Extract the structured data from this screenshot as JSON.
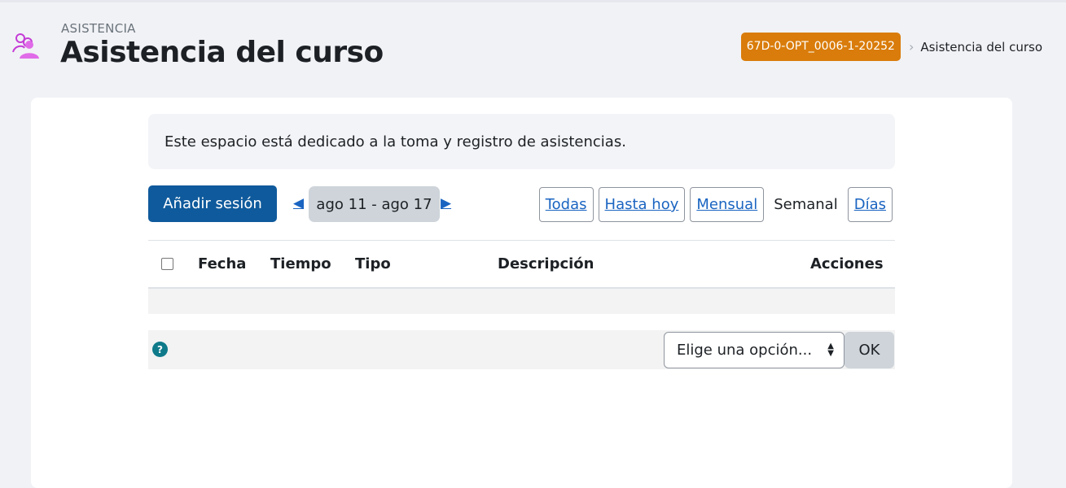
{
  "header": {
    "kicker": "ASISTENCIA",
    "title": "Asistencia del curso",
    "icon": "users-icon"
  },
  "breadcrumb": {
    "course_badge": "67D-0-OPT_0006-1-20252",
    "separator": "›",
    "current": "Asistencia del curso"
  },
  "intro": {
    "text": "Este espacio está dedicado a la toma y registro de asistencias."
  },
  "toolbar": {
    "add_session_label": "Añadir sesión",
    "prev_label": "◀",
    "date_range": "ago 11 - ago 17",
    "next_label": "▶",
    "views": {
      "all": "Todas",
      "until_today": "Hasta hoy",
      "monthly": "Mensual",
      "weekly": "Semanal",
      "days": "Días"
    }
  },
  "table": {
    "columns": [
      "Fecha",
      "Tiempo",
      "Tipo",
      "Descripción",
      "Acciones"
    ],
    "rows": []
  },
  "footer": {
    "help_label": "?",
    "select_value": "Elige una opción...",
    "ok_label": "OK"
  },
  "colors": {
    "primary": "#0f5a9c",
    "badge": "#d97c0b",
    "link": "#1a64c1",
    "icon_purple": "#c43cd6",
    "help": "#0f7a8a"
  }
}
